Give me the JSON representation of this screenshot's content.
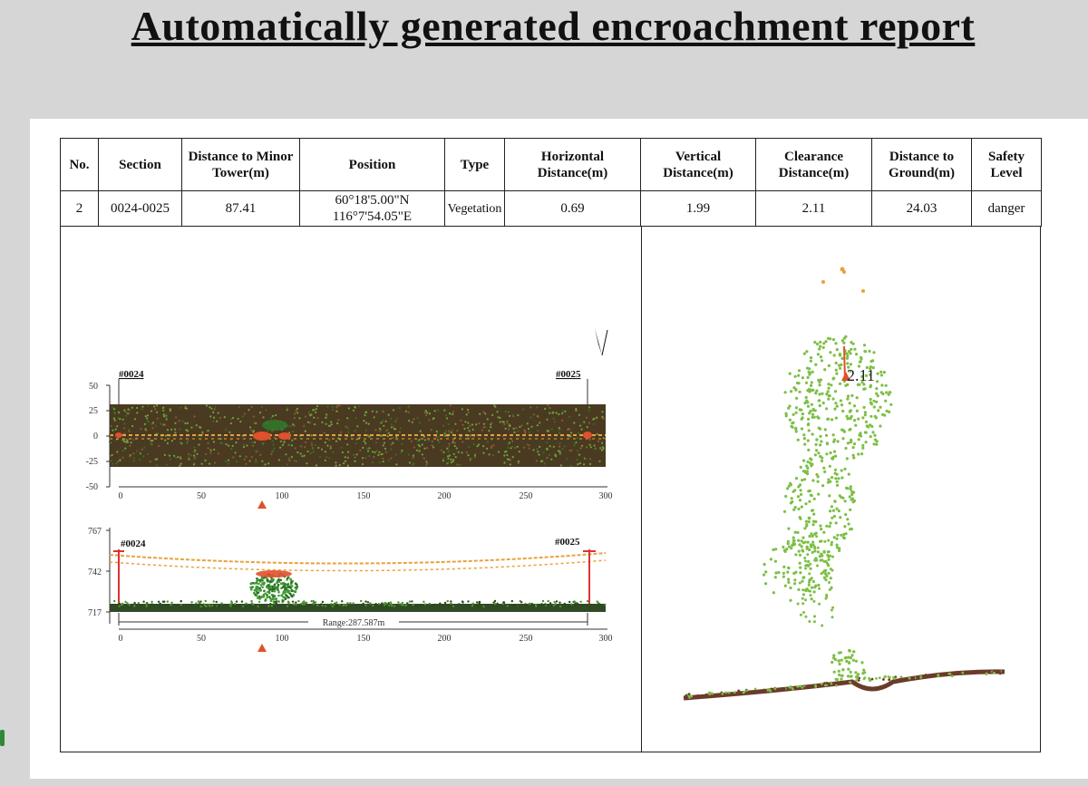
{
  "title": "Automatically generated encroachment report",
  "table": {
    "headers": {
      "no": "No.",
      "section": "Section",
      "distance_minor_tower": "Distance to Minor Tower(m)",
      "position": "Position",
      "type": "Type",
      "horizontal": "Horizontal Distance(m)",
      "vertical": "Vertical Distance(m)",
      "clearance": "Clearance Distance(m)",
      "ground": "Distance to Ground(m)",
      "safety": "Safety Level"
    },
    "row": {
      "no": "2",
      "section": "0024-0025",
      "distance_minor_tower": "87.41",
      "position_lat": "60°18'5.00\"N",
      "position_lon": "116°7'54.05\"E",
      "type": "Vegetation",
      "horizontal": "0.69",
      "vertical": "1.99",
      "clearance": "2.11",
      "ground": "24.03",
      "safety": "danger"
    }
  },
  "plan_view": {
    "tower_a": "#0024",
    "tower_b": "#0025",
    "y_ticks": [
      "50",
      "25",
      "0",
      "-25",
      "-50"
    ],
    "x_ticks": [
      "0",
      "50",
      "100",
      "150",
      "200",
      "250",
      "300"
    ]
  },
  "profile_view": {
    "tower_a": "#0024",
    "tower_b": "#0025",
    "y_ticks": [
      "767",
      "742",
      "717"
    ],
    "x_ticks": [
      "0",
      "50",
      "100",
      "150",
      "200",
      "250",
      "300"
    ],
    "range_label": "Range:287.587m"
  },
  "cross_section": {
    "clearance_label": "2.11"
  },
  "colors": {
    "vegetation": "#7cbf46",
    "ground": "#6b3b2a",
    "line": "#e8a23c",
    "marker": "#e0502c"
  }
}
